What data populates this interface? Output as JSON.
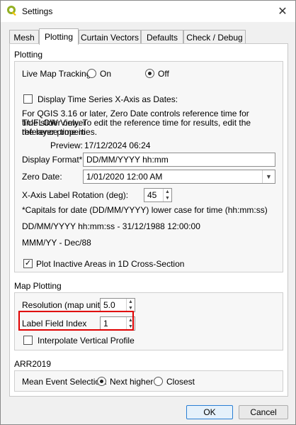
{
  "window": {
    "title": "Settings",
    "close_glyph": "✕",
    "icon": "qgis-logo-icon"
  },
  "tabs": [
    "Mesh",
    "Plotting",
    "Curtain Vectors",
    "Defaults",
    "Check / Debug"
  ],
  "active_tab": "Plotting",
  "plotting": {
    "group_title": "Plotting",
    "live_tracking_label": "Live Map Tracking:",
    "live_tracking_on": "On",
    "live_tracking_off": "Off",
    "live_tracking_value": "Off",
    "time_series_dates_label": "Display Time Series X-Axis as Dates:",
    "time_series_dates_checked": false,
    "info_line1": "For QGIS 3.16 or later, Zero Date controls reference time for TUFLOW Viewer",
    "info_line2": "time slider only. To edit the reference time for results, edit the reference time in",
    "info_line3": "the layer properties.",
    "preview_label": "Preview:",
    "preview_value": "17/12/2024 06:24",
    "display_format_label": "Display Format*:",
    "display_format_value": "DD/MM/YYYY hh:mm",
    "zero_date_label": "Zero Date:",
    "zero_date_value": "1/01/2020 12:00 AM",
    "rotation_label": "X-Axis Label Rotation (deg):",
    "rotation_value": "45",
    "capitals_note": "*Capitals for date (DD/MM/YYYY) lower case for time (hh:mm:ss)",
    "example1": "DD/MM/YYYY hh:mm:ss - 31/12/1988 12:00:00",
    "example2": "MMM/YY - Dec/88",
    "plot_inactive_label": "Plot Inactive Areas in 1D Cross-Section",
    "plot_inactive_checked": true
  },
  "map_plotting": {
    "group_title": "Map Plotting",
    "resolution_label": "Resolution (map units)",
    "resolution_value": "5.0",
    "label_field_index_label": "Label Field Index",
    "label_field_index_value": "1",
    "interpolate_label": "Interpolate Vertical Profile",
    "interpolate_checked": false
  },
  "arr": {
    "group_title": "ARR2019",
    "mean_event_label": "Mean Event Selection:",
    "option_next_higher": "Next higher",
    "option_closest": "Closest",
    "selected": "Next higher"
  },
  "buttons": {
    "ok": "OK",
    "cancel": "Cancel"
  },
  "colors": {
    "highlight": "#e00000",
    "qgis_green": "#93b023"
  }
}
